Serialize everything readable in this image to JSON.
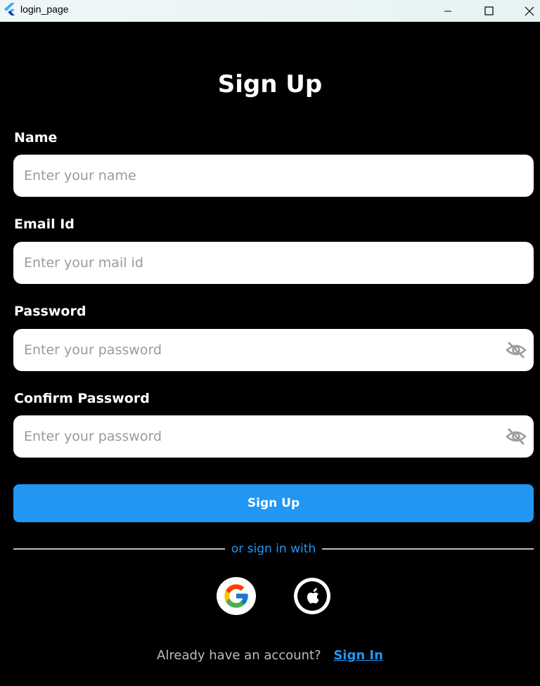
{
  "window": {
    "title": "login_page"
  },
  "page": {
    "title": "Sign Up"
  },
  "form": {
    "name": {
      "label": "Name",
      "placeholder": "Enter your name",
      "value": ""
    },
    "email": {
      "label": "Email Id",
      "placeholder": "Enter your mail id",
      "value": ""
    },
    "password": {
      "label": "Password",
      "placeholder": "Enter your password",
      "value": "",
      "icon": "eye-off-icon"
    },
    "confirm_password": {
      "label": "Confirm Password",
      "placeholder": "Enter your password",
      "value": "",
      "icon": "eye-off-icon"
    },
    "submit_label": "Sign Up"
  },
  "social": {
    "divider_text": "or sign in with",
    "providers": [
      {
        "name": "google",
        "icon": "google-icon"
      },
      {
        "name": "apple",
        "icon": "apple-icon"
      }
    ]
  },
  "footer": {
    "text": "Already have an account?",
    "link_label": "Sign In"
  },
  "colors": {
    "background": "#000000",
    "accent": "#2196f3",
    "field_bg": "#ffffff",
    "placeholder": "#9a9a9a"
  }
}
